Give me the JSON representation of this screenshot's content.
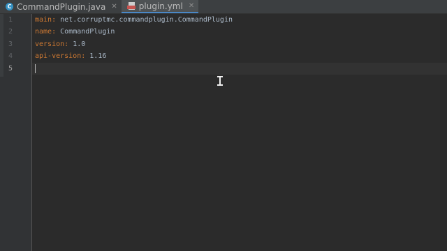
{
  "tabs": [
    {
      "label": "CommandPlugin.java",
      "icon": "java-class-icon",
      "active": false
    },
    {
      "label": "plugin.yml",
      "icon": "yaml-file-icon",
      "active": true
    }
  ],
  "line_numbers": [
    "1",
    "2",
    "3",
    "4",
    "5"
  ],
  "code": [
    {
      "key": "main",
      "value": " net.corruptmc.commandplugin.CommandPlugin"
    },
    {
      "key": "name",
      "value": " CommandPlugin"
    },
    {
      "key": "version",
      "value": " 1.0"
    },
    {
      "key": "api-version",
      "value": " 1.16"
    }
  ],
  "colors": {
    "editor_bg": "#2b2b2b",
    "gutter_bg": "#313335",
    "key": "#cc7832",
    "text": "#a9b7c6",
    "active_tab_underline": "#4a88c7"
  }
}
